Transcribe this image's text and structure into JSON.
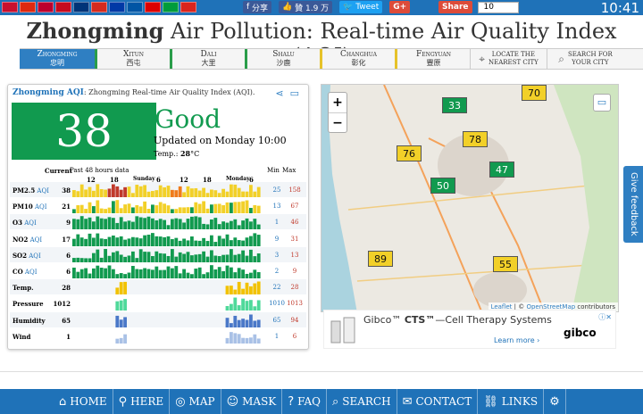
{
  "topbar": {
    "flags": [
      "#c8102e",
      "#de2910",
      "#bc002d",
      "#c60b1e",
      "#003478",
      "#d52b1e",
      "#0039a6",
      "#0055a4",
      "#dd0000",
      "#009c3b",
      "#da251d"
    ],
    "share_label": "分享",
    "like_label": "贊 1.9 万",
    "tweet_label": "Tweet",
    "gplus_label": "G+",
    "share2_label": "Share",
    "share2_count": "10",
    "clock": "10:41"
  },
  "title": {
    "bold": "Zhongming",
    "rest": " Air Pollution: Real-time Air Quality Index (AQI)"
  },
  "nav": {
    "tabs": [
      {
        "en": "Zhongming",
        "cn": "忠明"
      },
      {
        "en": "Xitun",
        "cn": "西屯"
      },
      {
        "en": "Dali",
        "cn": "大里"
      },
      {
        "en": "Shalu",
        "cn": "沙鹿"
      },
      {
        "en": "Changhua",
        "cn": "彰化"
      },
      {
        "en": "Fengyuan",
        "cn": "豐原"
      }
    ],
    "locate": {
      "icon": "crosshair-icon",
      "line1": "LOCATE THE",
      "line2": "NEAREST CITY"
    },
    "search": {
      "icon": "search-icon",
      "line1": "SEARCH FOR",
      "line2": "YOUR CITY"
    }
  },
  "panel": {
    "title_bold": "Zhongming AQI",
    "title_rest": ": Zhongming Real-time Air Quality Index (AQI).",
    "aqi": "38",
    "status": "Good",
    "updated": "Updated on Monday 10:00",
    "temp_label": "Temp.: ",
    "temp_value": "28",
    "temp_unit": "°C",
    "hist_current": "Current",
    "hist_past": "Past 48 hours data",
    "hist_min": "Min",
    "hist_max": "Max",
    "time_ticks": [
      "12",
      "18",
      "Sunday",
      "6",
      "12",
      "18",
      "Monday",
      "6"
    ],
    "colors": {
      "good": "#119a4f",
      "moderate": "#f2d028",
      "usg": "#f07b1b",
      "unhealthy": "#c0392b"
    },
    "rows": [
      {
        "label": "PM2.5",
        "unit": "AQI",
        "value": "38",
        "min": "25",
        "max": "158",
        "color": "#f2d028"
      },
      {
        "label": "PM10",
        "unit": "AQI",
        "value": "21",
        "min": "13",
        "max": "67",
        "color": "#f2d028"
      },
      {
        "label": "O3",
        "unit": "AQI",
        "value": "9",
        "min": "1",
        "max": "46",
        "color": "#119a4f"
      },
      {
        "label": "NO2",
        "unit": "AQI",
        "value": "17",
        "min": "9",
        "max": "31",
        "color": "#119a4f"
      },
      {
        "label": "SO2",
        "unit": "AQI",
        "value": "6",
        "min": "3",
        "max": "13",
        "color": "#119a4f"
      },
      {
        "label": "CO",
        "unit": "AQI",
        "value": "6",
        "min": "2",
        "max": "9",
        "color": "#119a4f"
      },
      {
        "label": "Temp.",
        "unit": "",
        "value": "28",
        "min": "22",
        "max": "28",
        "color": "#f2c200"
      },
      {
        "label": "Pressure",
        "unit": "",
        "value": "1012",
        "min": "1010",
        "max": "1013",
        "color": "#4fd99a"
      },
      {
        "label": "Humidity",
        "unit": "",
        "value": "65",
        "min": "65",
        "max": "94",
        "color": "#4a78c8"
      },
      {
        "label": "Wind",
        "unit": "",
        "value": "1",
        "min": "1",
        "max": "6",
        "color": "#a9c1e6"
      }
    ]
  },
  "map": {
    "markers": [
      {
        "value": "70",
        "kind": "moderate"
      },
      {
        "value": "33",
        "kind": "good"
      },
      {
        "value": "78",
        "kind": "moderate"
      },
      {
        "value": "76",
        "kind": "moderate"
      },
      {
        "value": "47",
        "kind": "good"
      },
      {
        "value": "50",
        "kind": "good"
      },
      {
        "value": "89",
        "kind": "moderate"
      },
      {
        "value": "55",
        "kind": "moderate"
      }
    ],
    "attribution_leaflet": "Leaflet",
    "attribution_sep": " | © ",
    "attribution_osm": "OpenStreetMap",
    "attribution_rest": " contributors"
  },
  "ad": {
    "headline_prefix": "Gibco™ ",
    "headline_bold": "CTS™",
    "headline_rest": "—Cell Therapy Systems",
    "more": "Learn more ›",
    "logo": "gibco",
    "adchoices": "ⓘ✕"
  },
  "feedback": "Give feedback",
  "bottomnav": [
    {
      "icon": "home-icon",
      "label": "HOME"
    },
    {
      "icon": "here-icon",
      "label": "HERE"
    },
    {
      "icon": "map-icon",
      "label": "MAP"
    },
    {
      "icon": "mask-icon",
      "label": "MASK"
    },
    {
      "icon": "faq-icon",
      "label": "FAQ"
    },
    {
      "icon": "search-icon",
      "label": "SEARCH"
    },
    {
      "icon": "contact-icon",
      "label": "CONTACT"
    },
    {
      "icon": "links-icon",
      "label": "LINKS"
    },
    {
      "icon": "gear-icon",
      "label": ""
    }
  ]
}
